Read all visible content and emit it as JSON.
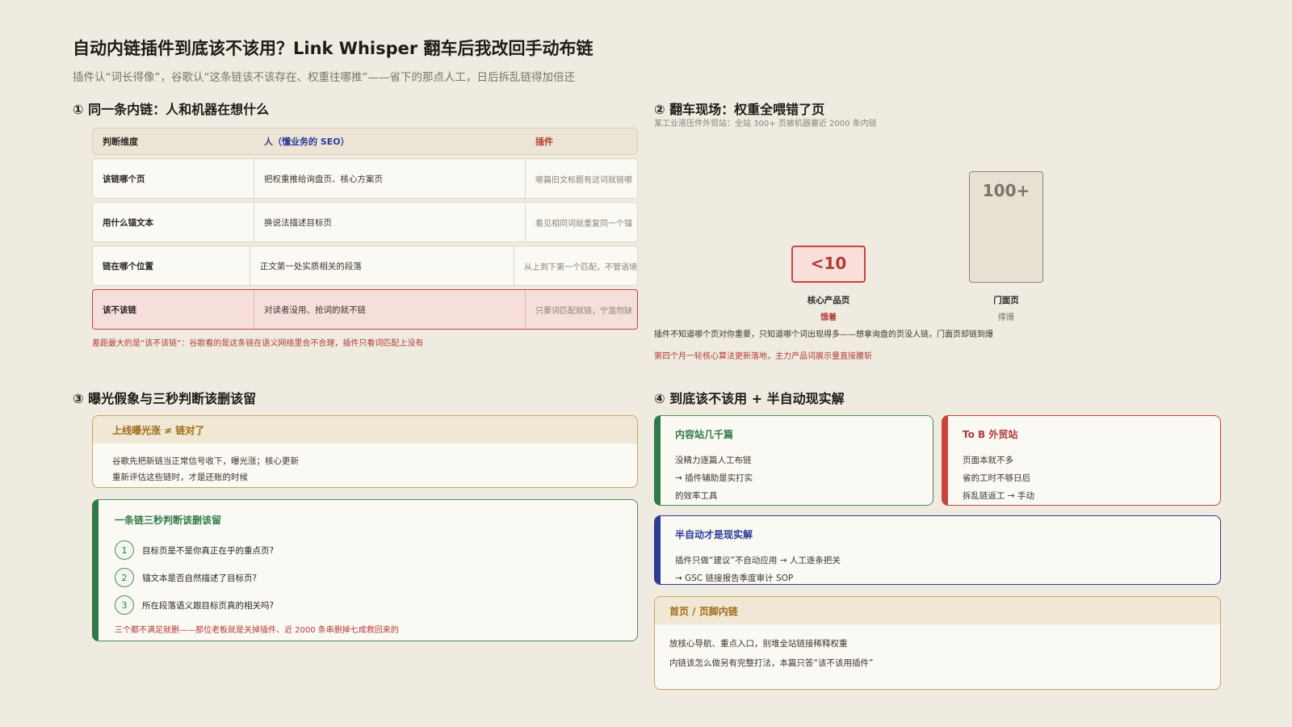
{
  "header": {
    "title": "自动内链插件到底该不该用？Link Whisper 翻车后我改回手动布链",
    "subtitle": "插件认“词长得像”，谷歌认“这条链该不该存在、权重往哪推”——省下的那点人工，日后拆乱链得加倍还"
  },
  "section1": {
    "title": "① 同一条内链：人和机器在想什么",
    "columns": [
      "判断维度",
      "人（懂业务的 SEO）",
      "插件"
    ],
    "rows": [
      [
        "该链哪个页",
        "把权重推给询盘页、核心方案页",
        "哪篇旧文标题有这词就链哪"
      ],
      [
        "用什么锚文本",
        "换说法描述目标页",
        "看见相同词就重复同一个锚"
      ],
      [
        "链在哪个位置",
        "正文第一处实质相关的段落",
        "从上到下第一个匹配，不管语境"
      ],
      [
        "该不该链",
        "对读者没用、抢词的就不链",
        "只要词匹配就链，宁滥勿缺"
      ]
    ],
    "note": "差距最大的是“该不该链”：谷歌看的是这条链在语义网络里合不合理，插件只看词匹配上没有"
  },
  "section2": {
    "title": "② 翻车现场：权重全喂错了页",
    "subtitle": "某工业液压件外贸站：全站 300+ 页被机器塞近 2000 条内链",
    "chart_data": {
      "type": "bar",
      "categories": [
        "核心产品页",
        "门面页"
      ],
      "value_labels": [
        "<10",
        "100+"
      ],
      "values": [
        10,
        100
      ],
      "status": [
        "饿着",
        "撑爆"
      ]
    },
    "colors": {
      "danger": "#c9443e",
      "neutral": "#8a8479"
    },
    "description": "插件不知道哪个页对你重要，只知道哪个词出现得多——想拿询盘的页没人链，门面页却链到爆",
    "note": "第四个月一轮核心算法更新落地，主力产品词展示量直接腰斩"
  },
  "section3": {
    "title": "③ 曝光假象与三秒判断该删该留",
    "warning": {
      "title": "上线曝光涨 ≠ 链对了",
      "lines": [
        "谷歌先把新链当正常信号收下，曝光涨；核心更新",
        "重新评估这些链时，才是还账的时候"
      ]
    },
    "checklist": {
      "title": "一条链三秒判断该删该留",
      "steps": [
        {
          "num": "1",
          "text": "目标页是不是你真正在乎的重点页?"
        },
        {
          "num": "2",
          "text": "锚文本是否自然描述了目标页?"
        },
        {
          "num": "3",
          "text": "所在段落语义跟目标页真的相关吗?"
        }
      ],
      "footer": "三个都不满足就删——那位老板就是关掉插件、近 2000 条串删掉七成救回来的"
    }
  },
  "section4": {
    "title": "④ 到底该不该用 + 半自动现实解",
    "cards": [
      {
        "title": "内容站几千篇",
        "lines": [
          "没精力逐篇人工布链",
          "→ 插件辅助是实打实",
          "的效率工具"
        ]
      },
      {
        "title": "To B 外贸站",
        "lines": [
          "页面本就不多",
          "省的工时不够日后",
          "拆乱链返工 → 手动"
        ]
      },
      {
        "title": "半自动才是现实解",
        "lines": [
          "插件只做“建议”不自动应用 → 人工逐条把关",
          "→ GSC 链接报告季度审计 SOP"
        ]
      },
      {
        "title": "首页 / 页脚内链",
        "lines": [
          "放核心导航、重点入口，别堆全站链接稀释权重",
          "内链该怎么做另有完整打法，本篇只答“该不该用插件”"
        ]
      }
    ]
  }
}
